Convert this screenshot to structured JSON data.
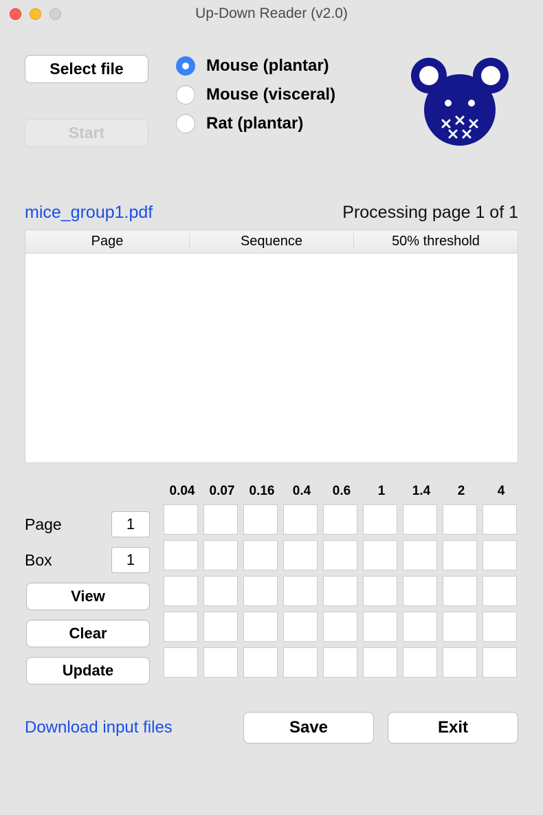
{
  "window": {
    "title": "Up-Down Reader (v2.0)"
  },
  "buttons": {
    "select_file": "Select file",
    "start": "Start",
    "view": "View",
    "clear": "Clear",
    "update": "Update",
    "save": "Save",
    "exit": "Exit"
  },
  "radios": {
    "opt1": "Mouse (plantar)",
    "opt2": "Mouse (visceral)",
    "opt3": "Rat (plantar)",
    "selected": "opt1"
  },
  "file": {
    "name": "mice_group1.pdf",
    "status": "Processing page 1 of 1"
  },
  "table": {
    "columns": [
      "Page",
      "Sequence",
      "50% threshold"
    ]
  },
  "inputs": {
    "page_label": "Page",
    "page_value": "1",
    "box_label": "Box",
    "box_value": "1"
  },
  "grid": {
    "headers": [
      "0.04",
      "0.07",
      "0.16",
      "0.4",
      "0.6",
      "1",
      "1.4",
      "2",
      "4"
    ],
    "rows": 5
  },
  "links": {
    "download": "Download input files"
  }
}
